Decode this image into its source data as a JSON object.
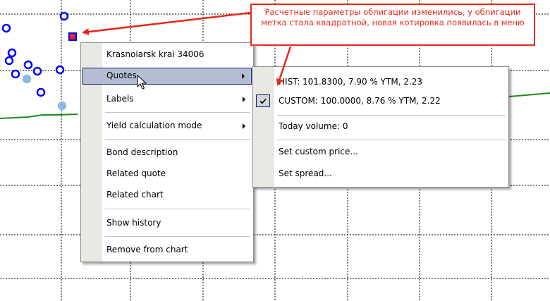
{
  "colors": {
    "grid": "#000000",
    "point_blue": "#0000ff",
    "point_light": "#8fb8e8",
    "curve_green": "#1a8a1a",
    "selected_square": "#e8281a",
    "annotation_red": "#e8281a",
    "menu_highlight": "#b6bdd2"
  },
  "annotation": {
    "text": "Расчетные параметры облигации изменились, у облигации метка стала квадратной, новая котировка появилась в меню"
  },
  "context_menu": {
    "header": "Krasnoiarsk krai 34006",
    "items": [
      {
        "label": "Quotes",
        "has_submenu": true,
        "highlighted": true
      },
      {
        "label": "Labels",
        "has_submenu": true
      },
      {
        "label": "Yield calculation mode",
        "has_submenu": true
      },
      {
        "label": "Bond description"
      },
      {
        "label": "Related quote"
      },
      {
        "label": "Related chart"
      },
      {
        "label": "Show history"
      },
      {
        "label": "Remove from chart"
      }
    ]
  },
  "quotes_submenu": {
    "items": [
      {
        "label": "HIST: 101.8300, 7.90 % YTM, 2.23",
        "checked": false
      },
      {
        "label": "CUSTOM: 100.0000, 8.76 % YTM, 2.22",
        "checked": true
      },
      {
        "label": "Today volume: 0"
      },
      {
        "label": "Set custom price..."
      },
      {
        "label": "Set spread..."
      }
    ]
  },
  "icons": {
    "check": "check-icon",
    "submenu_arrow": "submenu-arrow-icon",
    "cursor": "mouse-pointer-icon"
  }
}
